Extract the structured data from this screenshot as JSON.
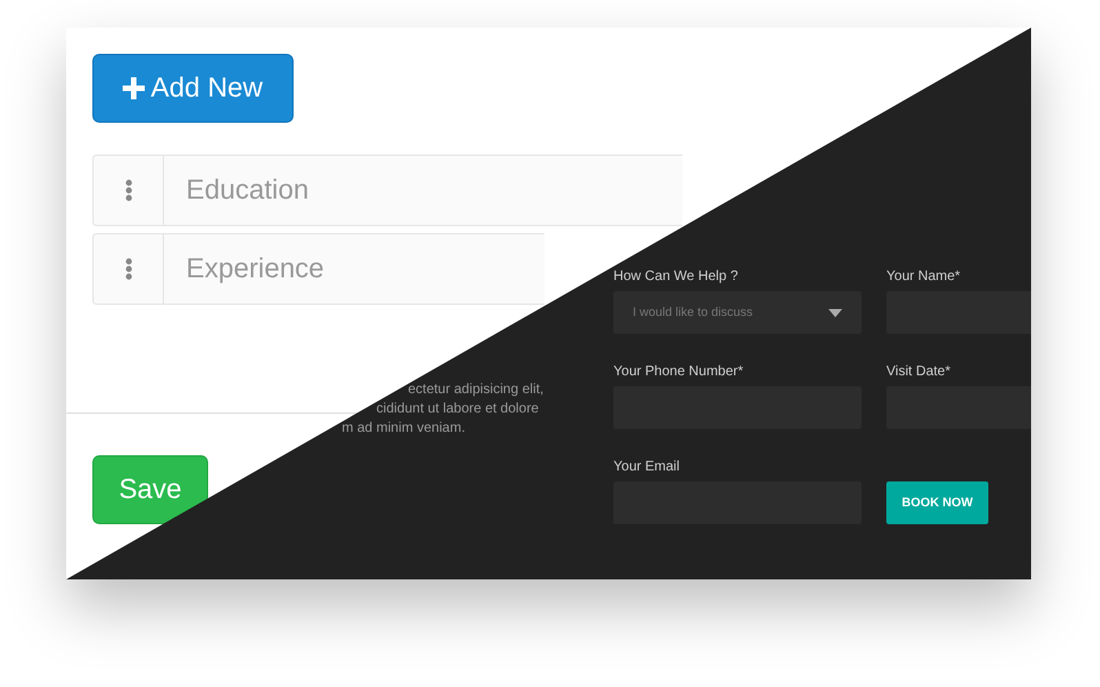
{
  "light_panel": {
    "add_button": "Add New",
    "sections": [
      {
        "label": "Education"
      },
      {
        "label": "Experience"
      }
    ],
    "save_button": "Save"
  },
  "dark_panel": {
    "paragraph_lines": [
      "ectetur adipisicing elit,",
      "cididunt ut labore et dolore",
      "m ad minim veniam."
    ],
    "form": {
      "fields": [
        {
          "kind": "select",
          "label": "How Can We Help ?",
          "placeholder": "I would like to discuss"
        },
        {
          "kind": "text",
          "label": "Your Name*"
        },
        {
          "kind": "text",
          "label": "Your Phone Number*"
        },
        {
          "kind": "text",
          "label": "Visit Date*"
        },
        {
          "kind": "text",
          "label": "Your Email"
        }
      ],
      "submit_button": "BOOK NOW"
    }
  }
}
